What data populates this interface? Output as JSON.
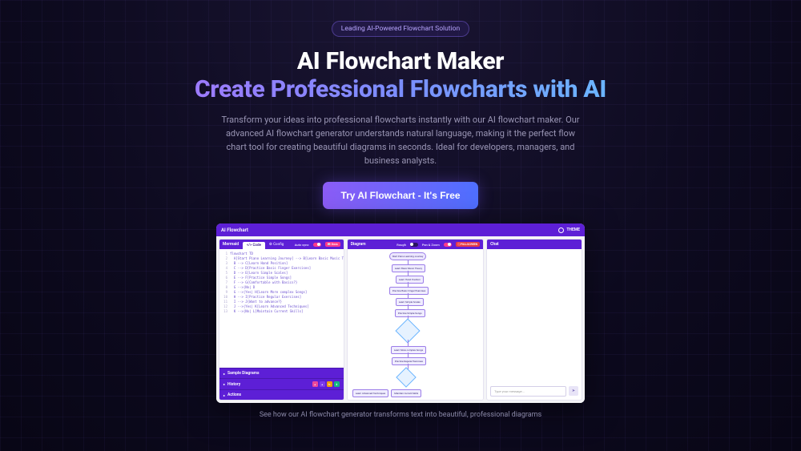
{
  "badge": "Leading AI-Powered Flowchart Solution",
  "hero": {
    "line1": "AI Flowchart Maker",
    "line2": "Create Professional Flowcharts with AI"
  },
  "sub": "Transform your ideas into professional flowcharts instantly with our AI flowchart maker. Our advanced AI flowchart generator understands natural language, making it the perfect flow chart tool for creating beautiful diagrams in seconds. Ideal for developers, managers, and business analysts.",
  "cta": "Try AI Flowchart - It's Free",
  "preview": {
    "app_title": "AI Flowchart",
    "theme_label": "THEME",
    "left": {
      "title": "Mermaid",
      "tab_code": "</> Code",
      "tab_config": "⚙ Config",
      "autosync_label": "Auto sync",
      "docs_pill": "📖 Docs",
      "code": [
        "flowchart TD",
        "  A[Start Piano Learning Journey] --> B[Learn Basic Music Theo…",
        "  B --> C[Learn Hand Position]",
        "  C --> D[Practice Basic Finger Exercises]",
        "  D --> E[Learn Simple Scales]",
        "  E --> F[Practice Simple Songs]",
        "  F --> G{Comfortable with Basics?}",
        "  G -->|No| D",
        "  G -->|Yes| H[Learn More complex Songs]",
        "  H --> I[Practice Regular Exercises]",
        "  I --> J{Want to advance?}",
        "  J -->|Yes| K[Learn Advanced Techniques]",
        "  K -->|No| L[Maintain Current Skills]"
      ],
      "accordion": {
        "sample": "Sample Diagrams",
        "history": "History",
        "actions": "Actions"
      }
    },
    "mid": {
      "title": "Diagram",
      "rough_label": "Rough",
      "pan_label": "Pan & Zoom",
      "fullscreen": "⛶ FULLSCREEN",
      "nodes": {
        "start": "Start Piano Learning Journey",
        "theory": "Learn Basic Music Theory",
        "hand": "Learn Hand Position",
        "finger": "Practice Basic Finger Exercises",
        "scales": "Learn Simple Scales",
        "songs": "Practice Simple Songs",
        "complex": "Learn More complex Songs",
        "regular": "Practice Regular Exercises",
        "advanced": "Learn Advanced Techniques",
        "maintain": "Maintain Current Skills"
      }
    },
    "right": {
      "title": "Chat",
      "placeholder": "Type your message...",
      "send_icon": "➤"
    }
  },
  "caption": "See how our AI flowchart generator transforms text into beautiful, professional diagrams"
}
